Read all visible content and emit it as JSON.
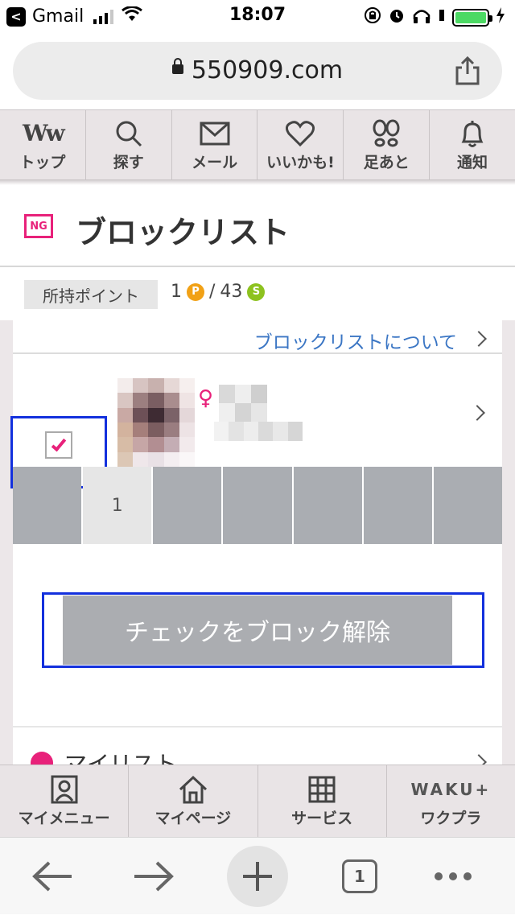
{
  "status_bar": {
    "back_app": "Gmail",
    "time": "18:07"
  },
  "url_bar": {
    "url": "550909.com"
  },
  "top_nav": {
    "items": [
      {
        "label": "トップ",
        "icon": "ww-logo-icon"
      },
      {
        "label": "探す",
        "icon": "search-icon"
      },
      {
        "label": "メール",
        "icon": "mail-icon"
      },
      {
        "label": "いいかも!",
        "icon": "heart-icon"
      },
      {
        "label": "足あと",
        "icon": "footprints-icon"
      },
      {
        "label": "通知",
        "icon": "bell-icon"
      }
    ],
    "logo_text": "Ww"
  },
  "page": {
    "badge": "NG",
    "title": "ブロックリスト"
  },
  "points": {
    "label": "所持ポイント",
    "p_value": "1",
    "separator": "/",
    "s_value": "43",
    "p_coin": "P",
    "s_coin": "S"
  },
  "about": {
    "link": "ブロックリストについて"
  },
  "blocked_user": {
    "gender_symbol": "♀",
    "checked": true
  },
  "pager": {
    "cells": [
      "",
      "1",
      "",
      "",
      "",
      "",
      ""
    ],
    "active_index": 1
  },
  "actions": {
    "unblock_label": "チェックをブロック解除"
  },
  "mylist": {
    "label": "マイリスト"
  },
  "site_nav": {
    "items": [
      {
        "label": "マイメニュー",
        "icon": "person-card-icon"
      },
      {
        "label": "マイページ",
        "icon": "home-icon"
      },
      {
        "label": "サービス",
        "icon": "grid-icon"
      },
      {
        "label": "ワクプラ",
        "icon": "waku-logo"
      }
    ],
    "waku_logo": "WAKU+"
  },
  "browser_toolbar": {
    "tab_count": "1"
  },
  "colors": {
    "accent_pink": "#e8217a",
    "link_blue": "#3b76c4",
    "highlight_blue": "#1330dd",
    "nav_bg": "#e9e4e6",
    "button_gray": "#abadb1"
  }
}
